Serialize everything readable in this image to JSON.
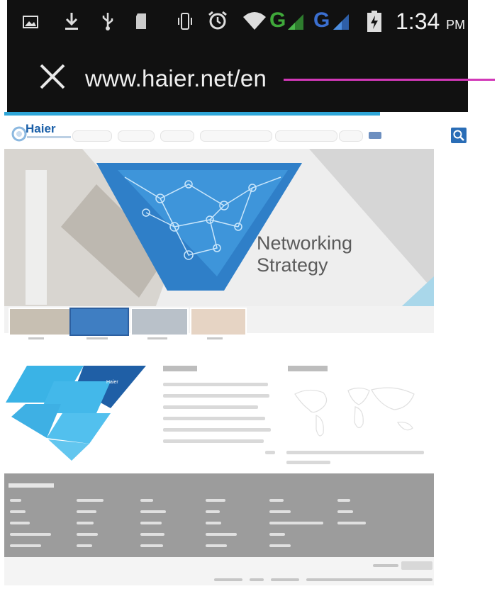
{
  "status_bar": {
    "time": "1:34",
    "ampm": "PM",
    "network_letter": "G",
    "icons": [
      "image-icon",
      "download-icon",
      "usb-icon",
      "sd-card-icon",
      "vibrate-icon",
      "alarm-icon",
      "wifi-icon",
      "signal-icon",
      "battery-charging-icon"
    ]
  },
  "browser": {
    "url": "www.haier.net/en",
    "close_icon": "close-icon"
  },
  "site": {
    "logo": "Haier",
    "hero_title_line1": "Networking",
    "hero_title_line2": "Strategy",
    "diamond_primary": "Haier"
  },
  "colors": {
    "status_bg": "#111111",
    "accent": "#2fa6d8",
    "brand": "#1a5fa8",
    "pointer": "#d238b8",
    "footer": "#9c9c9c"
  }
}
